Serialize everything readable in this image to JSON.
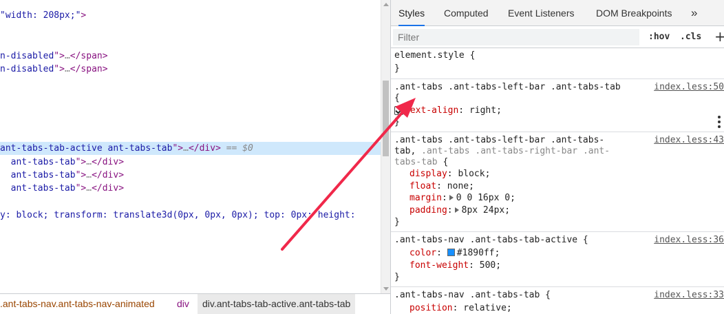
{
  "elements": {
    "line1": {
      "val": "\"width: 208px;\"",
      "punct": ">"
    },
    "line2": {
      "attr": "n-disabled",
      "quote": "\">",
      "ellipsis": "…",
      "close": "</span>"
    },
    "line3": {
      "attr": "n-disabled",
      "quote": "\">",
      "ellipsis": "…",
      "close": "</span>"
    },
    "selected": {
      "val": "ant-tabs-tab-active ant-tabs-tab",
      "quote": "\">",
      "ellipsis": "…",
      "close": "</div>",
      "eq": " == ",
      "dollar": "$0"
    },
    "tab_rows": [
      {
        "val": "ant-tabs-tab",
        "quote": "\">",
        "ellipsis": "…",
        "close": "</div>"
      },
      {
        "val": "ant-tabs-tab",
        "quote": "\">",
        "ellipsis": "…",
        "close": "</div>"
      },
      {
        "val": "ant-tabs-tab",
        "quote": "\">",
        "ellipsis": "…",
        "close": "</div>"
      }
    ],
    "style_line": "y: block; transform: translate3d(0px, 0px, 0px); top: 0px; height:"
  },
  "breadcrumb": {
    "items": [
      ".ant-tabs-nav.ant-tabs-nav-animated",
      "div",
      "div.ant-tabs-tab-active.ant-tabs-tab"
    ]
  },
  "styles_pane": {
    "tabs": [
      "Styles",
      "Computed",
      "Event Listeners",
      "DOM Breakpoints"
    ],
    "more": "»",
    "filter_placeholder": "Filter",
    "hov": ":hov",
    "cls": ".cls",
    "plus": "+",
    "rules": {
      "element_style": {
        "selector": "element.style {",
        "close": "}"
      },
      "rule1": {
        "selector": ".ant-tabs .ant-tabs-left-bar .ant-tabs-tab",
        "open": "{",
        "source": "index.less:50",
        "prop": "text-align",
        "value": "right;",
        "close": "}"
      },
      "rule2": {
        "selector_l1": ".ant-tabs .ant-tabs-left-bar .ant-tabs-",
        "selector_l2a": "tab, ",
        "selector_l2b": ".ant-tabs .ant-tabs-right-bar .ant-",
        "selector_l3a": "tabs-tab",
        "selector_l3b": " {",
        "source": "index.less:43",
        "props": [
          {
            "name": "display",
            "value": "block;"
          },
          {
            "name": "float",
            "value": "none;"
          },
          {
            "name": "margin",
            "value": "0 0 16px 0;"
          },
          {
            "name": "padding",
            "value": "8px 24px;"
          }
        ],
        "close": "}"
      },
      "rule3": {
        "selector": ".ant-tabs-nav .ant-tabs-tab-active",
        "open": " {",
        "source": "index.less:36",
        "props": [
          {
            "name": "color",
            "value": "#1890ff;"
          },
          {
            "name": "font-weight",
            "value": "500;"
          }
        ],
        "close": "}"
      },
      "rule4": {
        "selector": ".ant-tabs-nav .ant-tabs-tab",
        "open": " {",
        "source": "index.less:33",
        "props": [
          {
            "name": "position",
            "value": "relative;"
          }
        ]
      }
    }
  },
  "colors": {
    "selected_row": "#cfe8fc",
    "active_tab_underline": "#1a73e8",
    "swatch": "#1890ff",
    "annotation_arrow": "#f0284a"
  }
}
